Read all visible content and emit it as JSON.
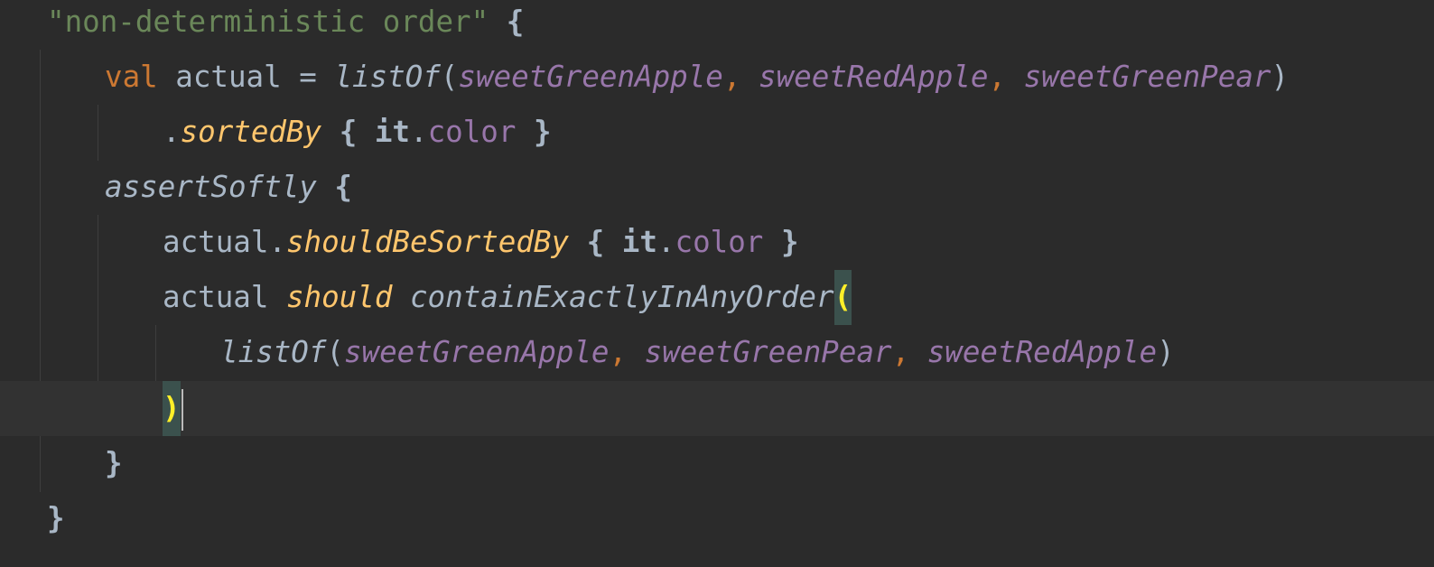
{
  "editor": {
    "language": "kotlin",
    "theme": "darcula",
    "colors": {
      "background": "#2b2b2b",
      "current_line": "#323232",
      "string": "#6a8759",
      "keyword": "#cc7832",
      "function_call": "#ffc66d",
      "property": "#9876aa",
      "default_text": "#a9b7c6",
      "brace_match": "#ffef28"
    },
    "lines": {
      "l1": {
        "string": "\"non-deterministic order\"",
        "space": " ",
        "brace": "{"
      },
      "l2": {
        "kw": "val",
        "sp1": " ",
        "name": "actual",
        "eq": " = ",
        "fn": "listOf",
        "open": "(",
        "a1": "sweetGreenApple",
        "c1": ",",
        "s1": " ",
        "a2": "sweetRedApple",
        "c2": ",",
        "s2": " ",
        "a3": "sweetGreenPear",
        "close": ")"
      },
      "l3": {
        "dot": ".",
        "fn": "sortedBy",
        "sp": " ",
        "open": "{",
        "sp2": " ",
        "it": "it",
        "dot2": ".",
        "prop": "color",
        "sp3": " ",
        "close": "}"
      },
      "l4": {
        "fn": "assertSoftly",
        "sp": " ",
        "brace": "{"
      },
      "l5": {
        "recv": "actual",
        "dot": ".",
        "fn": "shouldBeSortedBy",
        "sp": " ",
        "open": "{",
        "sp2": " ",
        "it": "it",
        "dot2": ".",
        "prop": "color",
        "sp3": " ",
        "close": "}"
      },
      "l6": {
        "recv": "actual",
        "sp1": " ",
        "infix": "should",
        "sp2": " ",
        "fn": "containExactlyInAnyOrder",
        "open": "("
      },
      "l7": {
        "fn": "listOf",
        "open": "(",
        "a1": "sweetGreenApple",
        "c1": ",",
        "s1": " ",
        "a2": "sweetGreenPear",
        "c2": ",",
        "s2": " ",
        "a3": "sweetRedApple",
        "close": ")"
      },
      "l8": {
        "close": ")"
      },
      "l9": {
        "close": "}"
      },
      "l10": {
        "close": "}"
      }
    }
  }
}
